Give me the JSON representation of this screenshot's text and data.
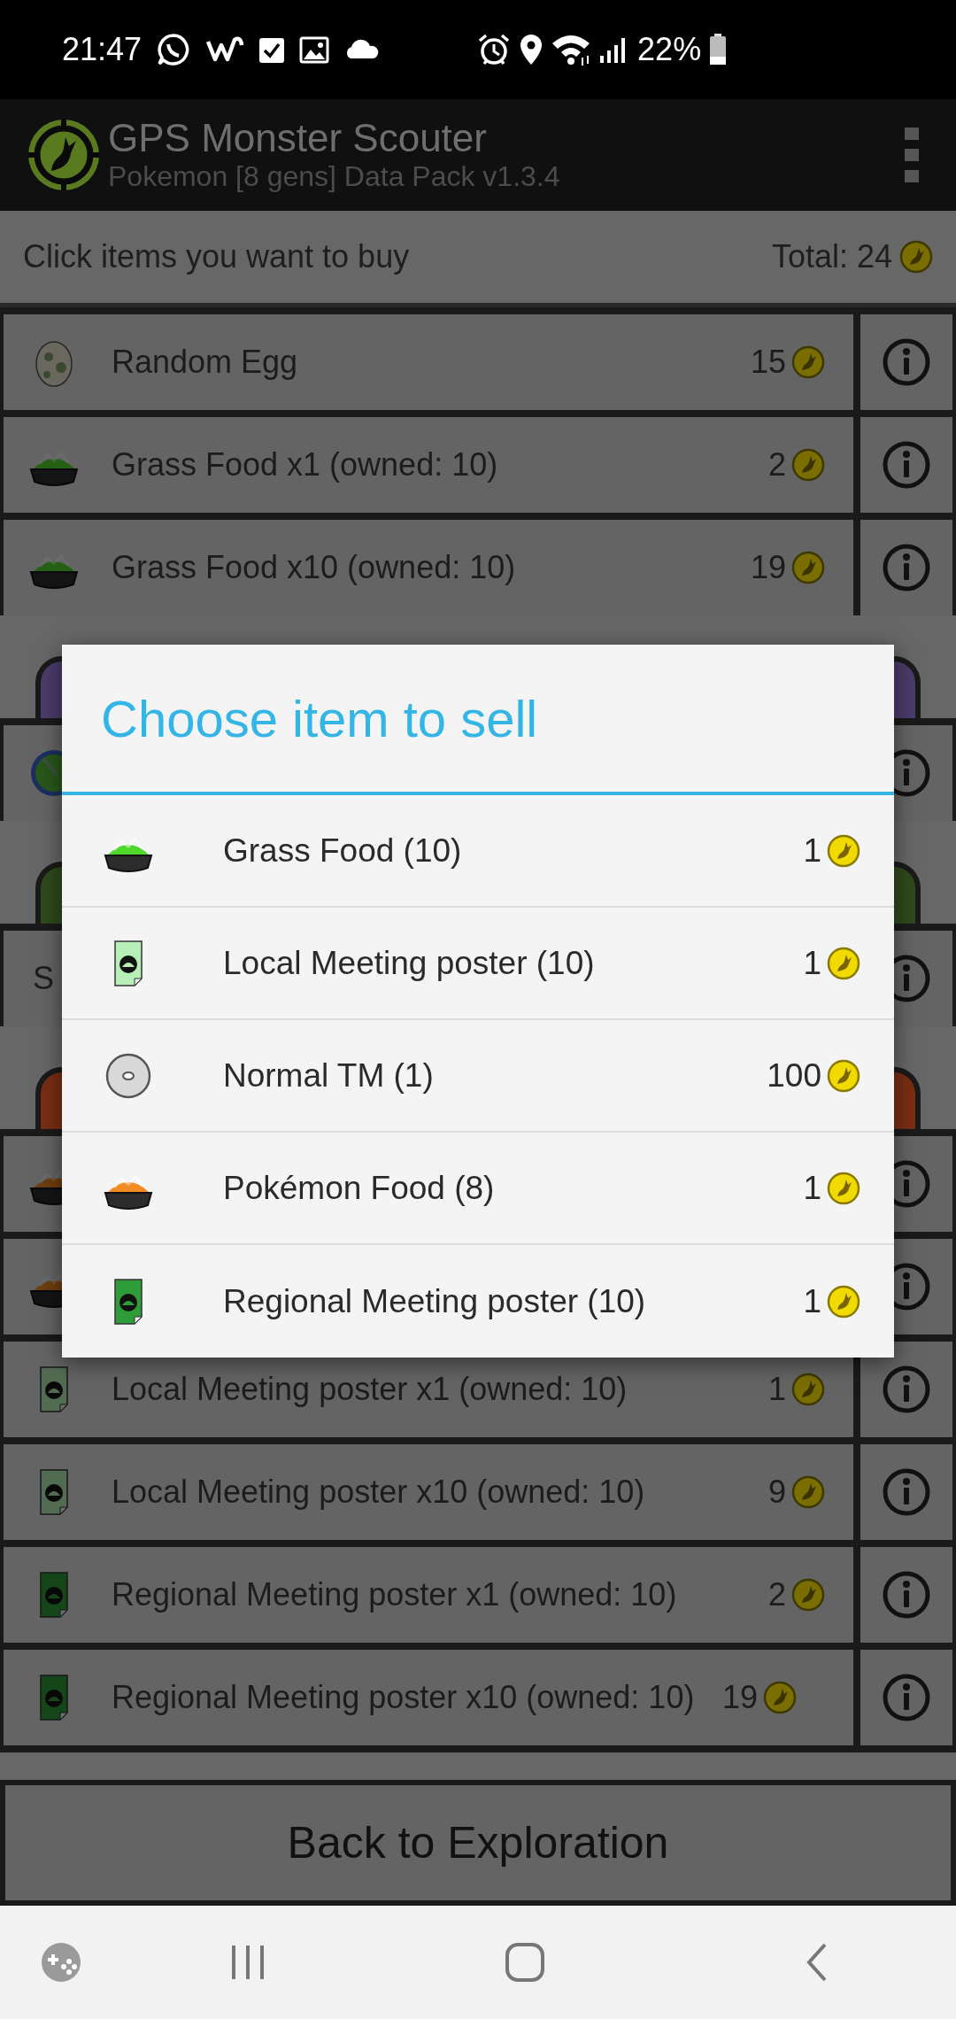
{
  "status_bar": {
    "time": "21:47",
    "battery": "22%"
  },
  "app_bar": {
    "title": "GPS Monster Scouter",
    "subtitle": "Pokemon [8 gens] Data Pack v1.3.4"
  },
  "shop_header": {
    "hint": "Click items you want to buy",
    "total": "Total: 24"
  },
  "shop_list": [
    {
      "kind": "egg",
      "name": "Random Egg",
      "price": "15"
    },
    {
      "kind": "grass-food",
      "name": "Grass Food x1 (owned: 10)",
      "price": "2"
    },
    {
      "kind": "grass-food",
      "name": "Grass Food x10 (owned: 10)",
      "price": "19"
    },
    {
      "kind": "section",
      "color": "#4b3c6c"
    },
    {
      "kind": "orb"
    },
    {
      "kind": "section",
      "color": "#2f4a1c"
    },
    {
      "kind": "text",
      "name": "S"
    },
    {
      "kind": "section",
      "color": "#7a2d14"
    },
    {
      "kind": "pokemon-food"
    },
    {
      "kind": "pokemon-food"
    },
    {
      "kind": "local-poster",
      "name": "Local Meeting poster x1 (owned: 10)",
      "price": "1"
    },
    {
      "kind": "local-poster",
      "name": "Local Meeting poster x10 (owned: 10)",
      "price": "9"
    },
    {
      "kind": "regional-poster",
      "name": "Regional Meeting poster x1 (owned: 10)",
      "price": "2"
    },
    {
      "kind": "regional-poster",
      "name": "Regional Meeting poster x10 (owned: 10)",
      "price": "19"
    }
  ],
  "dialog": {
    "title": "Choose item to sell",
    "items": [
      {
        "kind": "grass-food",
        "name": "Grass Food (10)",
        "price": "1"
      },
      {
        "kind": "local-poster",
        "name": "Local Meeting poster (10)",
        "price": "1"
      },
      {
        "kind": "tm-disc",
        "name": "Normal TM (1)",
        "price": "100"
      },
      {
        "kind": "pokemon-food",
        "name": "Pokémon Food (8)",
        "price": "1"
      },
      {
        "kind": "regional-poster",
        "name": "Regional Meeting poster (10)",
        "price": "1"
      }
    ]
  },
  "back_button": "Back to Exploration"
}
